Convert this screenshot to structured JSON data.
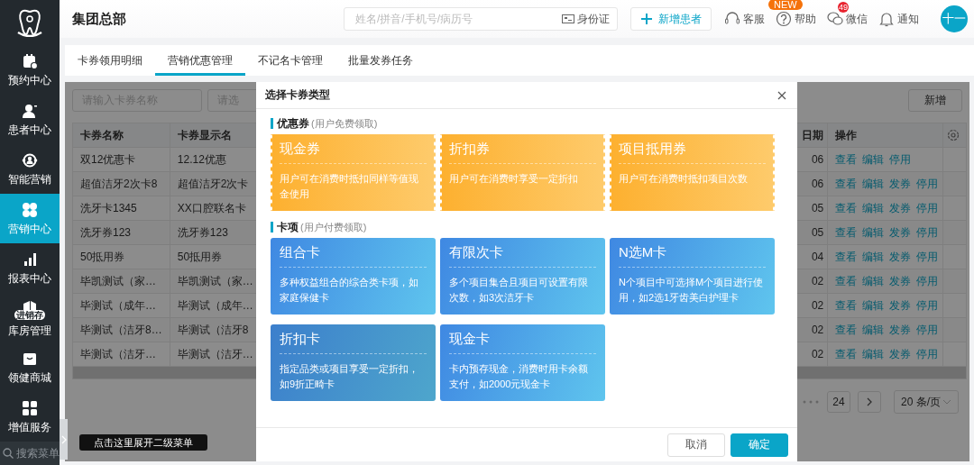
{
  "sidebar": {
    "items": [
      {
        "label": "预约中心",
        "selected": false
      },
      {
        "label": "患者中心",
        "selected": false
      },
      {
        "label": "智能营销",
        "selected": false
      },
      {
        "label": "营销中心",
        "selected": true
      },
      {
        "label": "报表中心",
        "selected": false
      },
      {
        "label": "库房管理",
        "selected": false,
        "icon_label": "进销存"
      },
      {
        "label": "领健商城",
        "selected": false
      },
      {
        "label": "增值服务",
        "selected": false
      }
    ],
    "search": {
      "placeholder": "搜索菜单"
    }
  },
  "header": {
    "title": "集团总部",
    "search": {
      "placeholder": "姓名/拼音/手机号/病历号",
      "id_button": "身份证"
    },
    "add_button": "新增患者",
    "actions": [
      {
        "label": "客服"
      },
      {
        "label": "帮助",
        "badge": {
          "text": "NEW",
          "kind": "tag"
        }
      },
      {
        "label": "微信",
        "badge": {
          "text": "49",
          "kind": "count"
        }
      },
      {
        "label": "通知"
      }
    ],
    "avatar": "十一"
  },
  "tabs": [
    {
      "label": "卡券领用明细",
      "selected": false
    },
    {
      "label": "营销优惠管理",
      "selected": true
    },
    {
      "label": "不记名卡管理",
      "selected": false
    },
    {
      "label": "批量发券任务",
      "selected": false
    }
  ],
  "filters": [
    {
      "placeholder": "请输入卡券名称"
    },
    {
      "placeholder": "请选"
    }
  ],
  "add_button": "新增",
  "table": {
    "columns": [
      "卡券名称",
      "卡券显示名",
      "日期",
      "操作"
    ],
    "rows": [
      {
        "cells": [
          "双12优惠卡",
          "12.12优惠",
          "06"
        ],
        "actions": [
          "查看",
          "编辑",
          "停用"
        ]
      },
      {
        "cells": [
          "超值洁牙2次卡8",
          "超值洁牙2次卡",
          "06"
        ],
        "actions": [
          "查看",
          "编辑",
          "发券",
          "停用"
        ]
      },
      {
        "cells": [
          "洗牙卡1345",
          "XX口腔联名卡",
          "05"
        ],
        "actions": [
          "查看",
          "编辑",
          "发券",
          "停用"
        ]
      },
      {
        "cells": [
          "洗牙券123",
          "洗牙券123",
          "05"
        ],
        "actions": [
          "查看",
          "编辑",
          "发券",
          "停用"
        ]
      },
      {
        "cells": [
          "50抵用券",
          "50抵用券",
          "04"
        ],
        "actions": [
          "查看",
          "编辑",
          "发券",
          "停用"
        ]
      },
      {
        "cells": [
          "毕凯测试（家…",
          "毕凯测试（家…",
          "02"
        ],
        "actions": [
          "查看",
          "编辑",
          "发券",
          "停用"
        ]
      },
      {
        "cells": [
          "毕测试（成年…",
          "毕测试（成年…",
          "02"
        ],
        "actions": [
          "查看",
          "编辑",
          "发券",
          "停用"
        ]
      },
      {
        "cells": [
          "毕测试（洁牙8…",
          "毕测试（洁牙8",
          "02"
        ],
        "actions": [
          "查看",
          "编辑",
          "发券",
          "停用"
        ]
      },
      {
        "cells": [
          "毕测试（洁牙…",
          "毕测试（洁牙…",
          "02"
        ],
        "actions": [
          "查看",
          "编辑",
          "发券",
          "停用"
        ]
      }
    ]
  },
  "pagination": {
    "page": "24",
    "page_size": "20 条/页"
  },
  "tooltip": "点击这里展开二级菜单",
  "dialog": {
    "title": "选择卡券类型",
    "sections": [
      {
        "title": "优惠券",
        "note": "(用户免费领取)",
        "kind": "coupon",
        "cards": [
          {
            "title": "现金券",
            "desc": "用户可在消费时抵扣同样等值现金使用",
            "selected": false
          },
          {
            "title": "折扣券",
            "desc": "用户可在消费时享受一定折扣",
            "selected": false
          },
          {
            "title": "项目抵用券",
            "desc": "用户可在消费时抵扣项目次数",
            "selected": false
          }
        ]
      },
      {
        "title": "卡项",
        "note": "(用户付费领取)",
        "kind": "card",
        "cards": [
          {
            "title": "组合卡",
            "desc": "多种权益组合的综合类卡项，如家庭保健卡",
            "selected": false
          },
          {
            "title": "有限次卡",
            "desc": "多个项目集合且项目可设置有限次数，如3次洁牙卡",
            "selected": false
          },
          {
            "title": "N选M卡",
            "desc": "N个项目中可选择M个项目进行使用，如2选1牙齿美白护理卡",
            "selected": false
          },
          {
            "title": "折扣卡",
            "desc": "指定品类或项目享受一定折扣，如9折正畸卡",
            "selected": true
          },
          {
            "title": "现金卡",
            "desc": "卡内预存现金，消费时用卡余额支付，如2000元现金卡",
            "selected": false
          }
        ]
      }
    ],
    "buttons": [
      {
        "label": "取消",
        "kind": "secondary"
      },
      {
        "label": "确定",
        "kind": "primary"
      }
    ]
  }
}
